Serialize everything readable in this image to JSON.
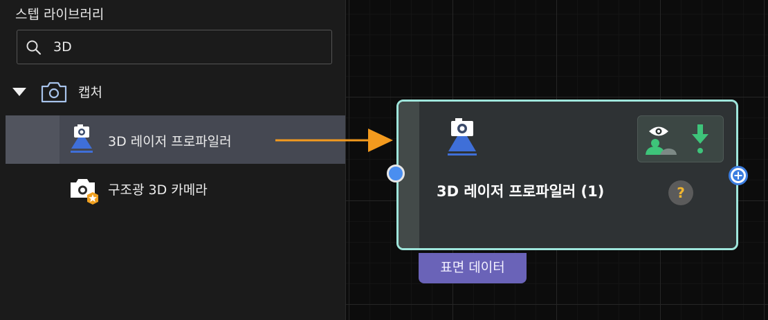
{
  "sidebar": {
    "title": "스텝 라이브러리",
    "search": {
      "value": "3D",
      "placeholder": ""
    },
    "category": {
      "label": "캡처",
      "icon": "camera-icon",
      "expanded": true
    },
    "items": [
      {
        "label": "3D 레이저 프로파일러",
        "icon": "laser-profiler-icon",
        "selected": true
      },
      {
        "label": "구조광 3D 카메라",
        "icon": "structured-light-camera-icon",
        "selected": false
      }
    ]
  },
  "canvas": {
    "node": {
      "title": "3D 레이저 프로파일러 (1)",
      "help": "?",
      "output_badge": "표면 데이터",
      "actions": [
        "visualize-icon",
        "download-icon"
      ]
    }
  },
  "colors": {
    "node_border": "#9fe6dc",
    "input_port": "#4a8ef0",
    "output_port": "#3b7de0",
    "badge": "#6a63b8",
    "arrow": "#f39a1e",
    "selected_item": "#454852"
  }
}
